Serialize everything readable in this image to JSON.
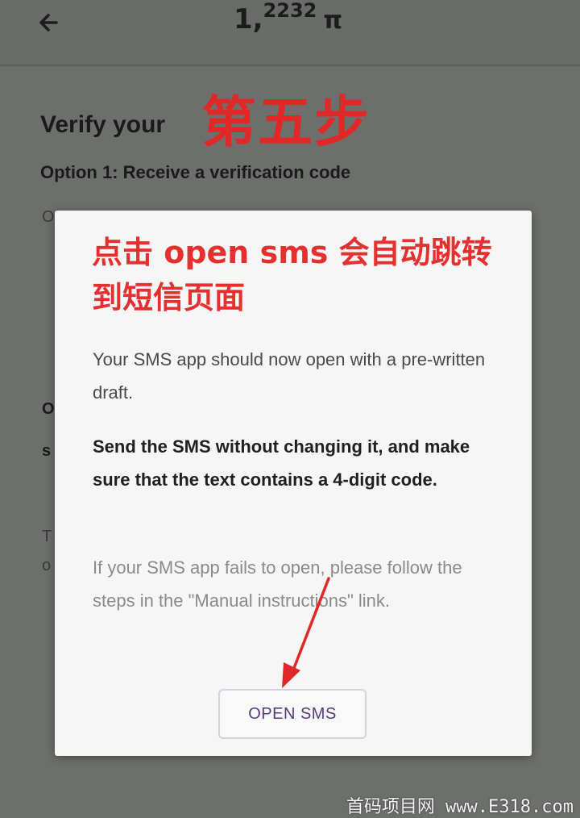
{
  "header": {
    "back_icon": "arrow-left-icon",
    "balance_integer": "1,",
    "balance_decimal": "2232",
    "currency_symbol": "π"
  },
  "annotation": {
    "step_label": "第五步",
    "instruction": "点击 open sms 会自动跳转到短信页面"
  },
  "background_page": {
    "heading": "Verify your",
    "option_1": "Option 1: Receive a verification code",
    "fragments": [
      "O",
      "O",
      "s",
      "T",
      "o"
    ]
  },
  "dialog": {
    "message_1": "Your SMS app should now open with a pre-written draft.",
    "message_2": "Send the SMS without changing it, and make sure that the text contains a 4-digit code.",
    "message_3": "If your SMS app fails to open, please follow the steps in the \"Manual instructions\" link.",
    "open_sms_label": "OPEN SMS",
    "accent_color": "#5a3b7a"
  },
  "watermark": "首码项目网 www.E318.com",
  "colors": {
    "annotation_red": "#e4302f",
    "overlay_gray": "#6d6f6c",
    "dialog_bg": "#f6f6f6"
  }
}
